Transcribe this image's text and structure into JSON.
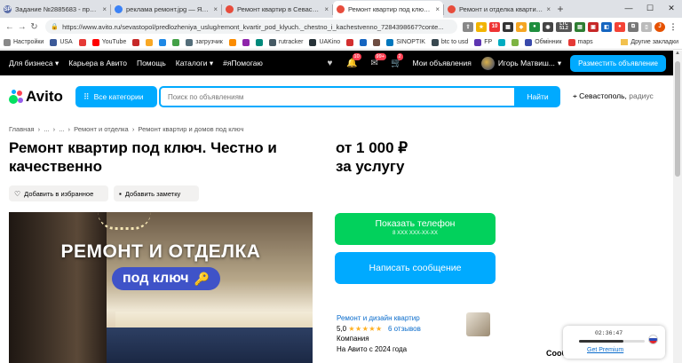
{
  "browser": {
    "tabs": [
      {
        "title": "Задание №2885683 - просмо",
        "fav": "SP",
        "color": "#5b6ea8",
        "active": false
      },
      {
        "title": "реклама ремонт.jpg — Яндек",
        "fav": "",
        "color": "#3b82f6",
        "active": false
      },
      {
        "title": "Ремонт квартир в Севастопол",
        "fav": "",
        "color": "#e74c3c",
        "active": false
      },
      {
        "title": "Ремонт квартир под ключ. Че",
        "fav": "",
        "color": "#e74c3c",
        "active": true
      },
      {
        "title": "Ремонт и отделка квартир Ка",
        "fav": "",
        "color": "#e74c3c",
        "active": false
      }
    ],
    "url": "https://www.avito.ru/sevastopol/predlozheniya_uslug/remont_kvartir_pod_klyuch._chestno_i_kachestvenno_7284398667?conte...",
    "bookmarks": [
      "Настройки",
      "USA",
      "",
      "YouTube",
      "",
      "",
      "",
      "",
      "загрузчик",
      "",
      "",
      "",
      "rutracker",
      "UAKino",
      "",
      "",
      "",
      "SINOPTIK",
      "btc to usd",
      "FP",
      "",
      "",
      "Обмінник",
      "maps"
    ],
    "bookmarks_right": "Другие закладки",
    "ltc_label": "LTC",
    "ltc_value": "51.2",
    "ext_badge": "10"
  },
  "avito_header": {
    "links": [
      "Для бизнеса",
      "Карьера в Авито",
      "Помощь",
      "Каталоги",
      "#яПомогаю"
    ],
    "badge_bell": "10",
    "badge_msg": "99+",
    "badge_cart": "2",
    "my_ads": "Мои объявления",
    "user": "Игорь Матвиш...",
    "post_ad": "Разместить объявление"
  },
  "search": {
    "logo": "Avito",
    "categories": "Все категории",
    "placeholder": "Поиск по объявлениям",
    "find": "Найти",
    "city": "Севастополь,",
    "radius": "радиус"
  },
  "listing": {
    "breadcrumb": [
      "Главная",
      "›",
      "...",
      "›",
      "...",
      "›",
      "Ремонт и отделка",
      "›",
      "Ремонт квартир и домов под ключ"
    ],
    "title": "Ремонт квартир под ключ. Честно и качественно",
    "price_line1": "от 1 000 ₽",
    "price_line2": "за услугу",
    "favorite": "Добавить в избранное",
    "note": "Добавить заметку",
    "photo_headline": "РЕМОНТ И ОТДЕЛКА",
    "photo_badge": "под ключ",
    "show_phone": "Показать телефон",
    "phone_mask": "8 XXX XXX-XX-XX",
    "write_message": "Написать сообщение"
  },
  "seller": {
    "name": "Ремонт и дизайн квартир",
    "rating": "5,0",
    "stars": "★★★★★",
    "reviews": "6 отзывов",
    "type": "Компания",
    "since": "На Авито с 2024 года"
  },
  "widget": {
    "time": "02:36:47",
    "progress": 0.67,
    "premium": "Get Premium",
    "chat_peek": "Сооб"
  }
}
